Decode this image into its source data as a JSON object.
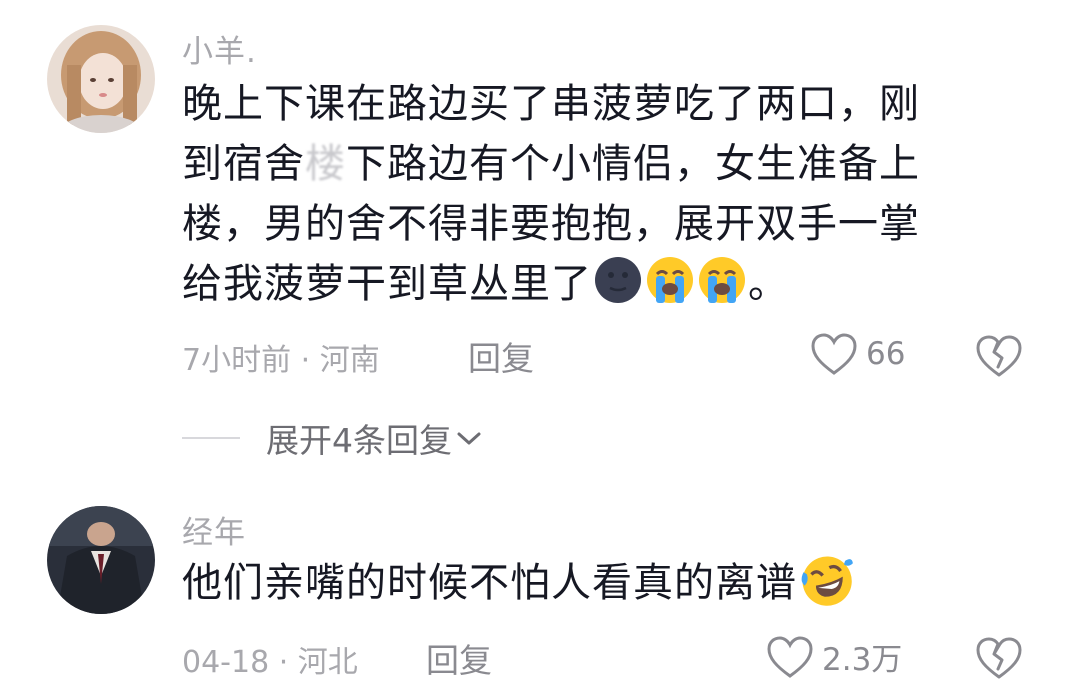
{
  "comments": [
    {
      "username": "小羊.",
      "text_line1": "晚上下课在路边买了串菠萝吃了两口，刚",
      "text_line2_a": "到宿舍",
      "text_line2_blur": "楼",
      "text_line2_b": "下路边有个小情侣，女生准备上",
      "text_line3": "楼，男的舍不得非要抱抱，展开双手一掌",
      "text_line4": "给我菠萝干到草丛里了",
      "text_line4_end": "。",
      "meta": "7小时前 · 河南",
      "reply_label": "回复",
      "like_count": "66",
      "expand_label": "展开4条回复",
      "emojis": [
        "new-moon-face-icon",
        "loudly-crying-face-icon",
        "loudly-crying-face-icon"
      ]
    },
    {
      "username": "经年",
      "text": "他们亲嘴的时候不怕人看真的离谱",
      "meta": "04-18 · 河北",
      "reply_label": "回复",
      "like_count": "2.3万",
      "emojis": [
        "face-with-tears-of-joy-icon"
      ]
    }
  ],
  "colors": {
    "text": "#161823",
    "secondary": "#a8a8ad",
    "icon": "#8a8a90"
  }
}
